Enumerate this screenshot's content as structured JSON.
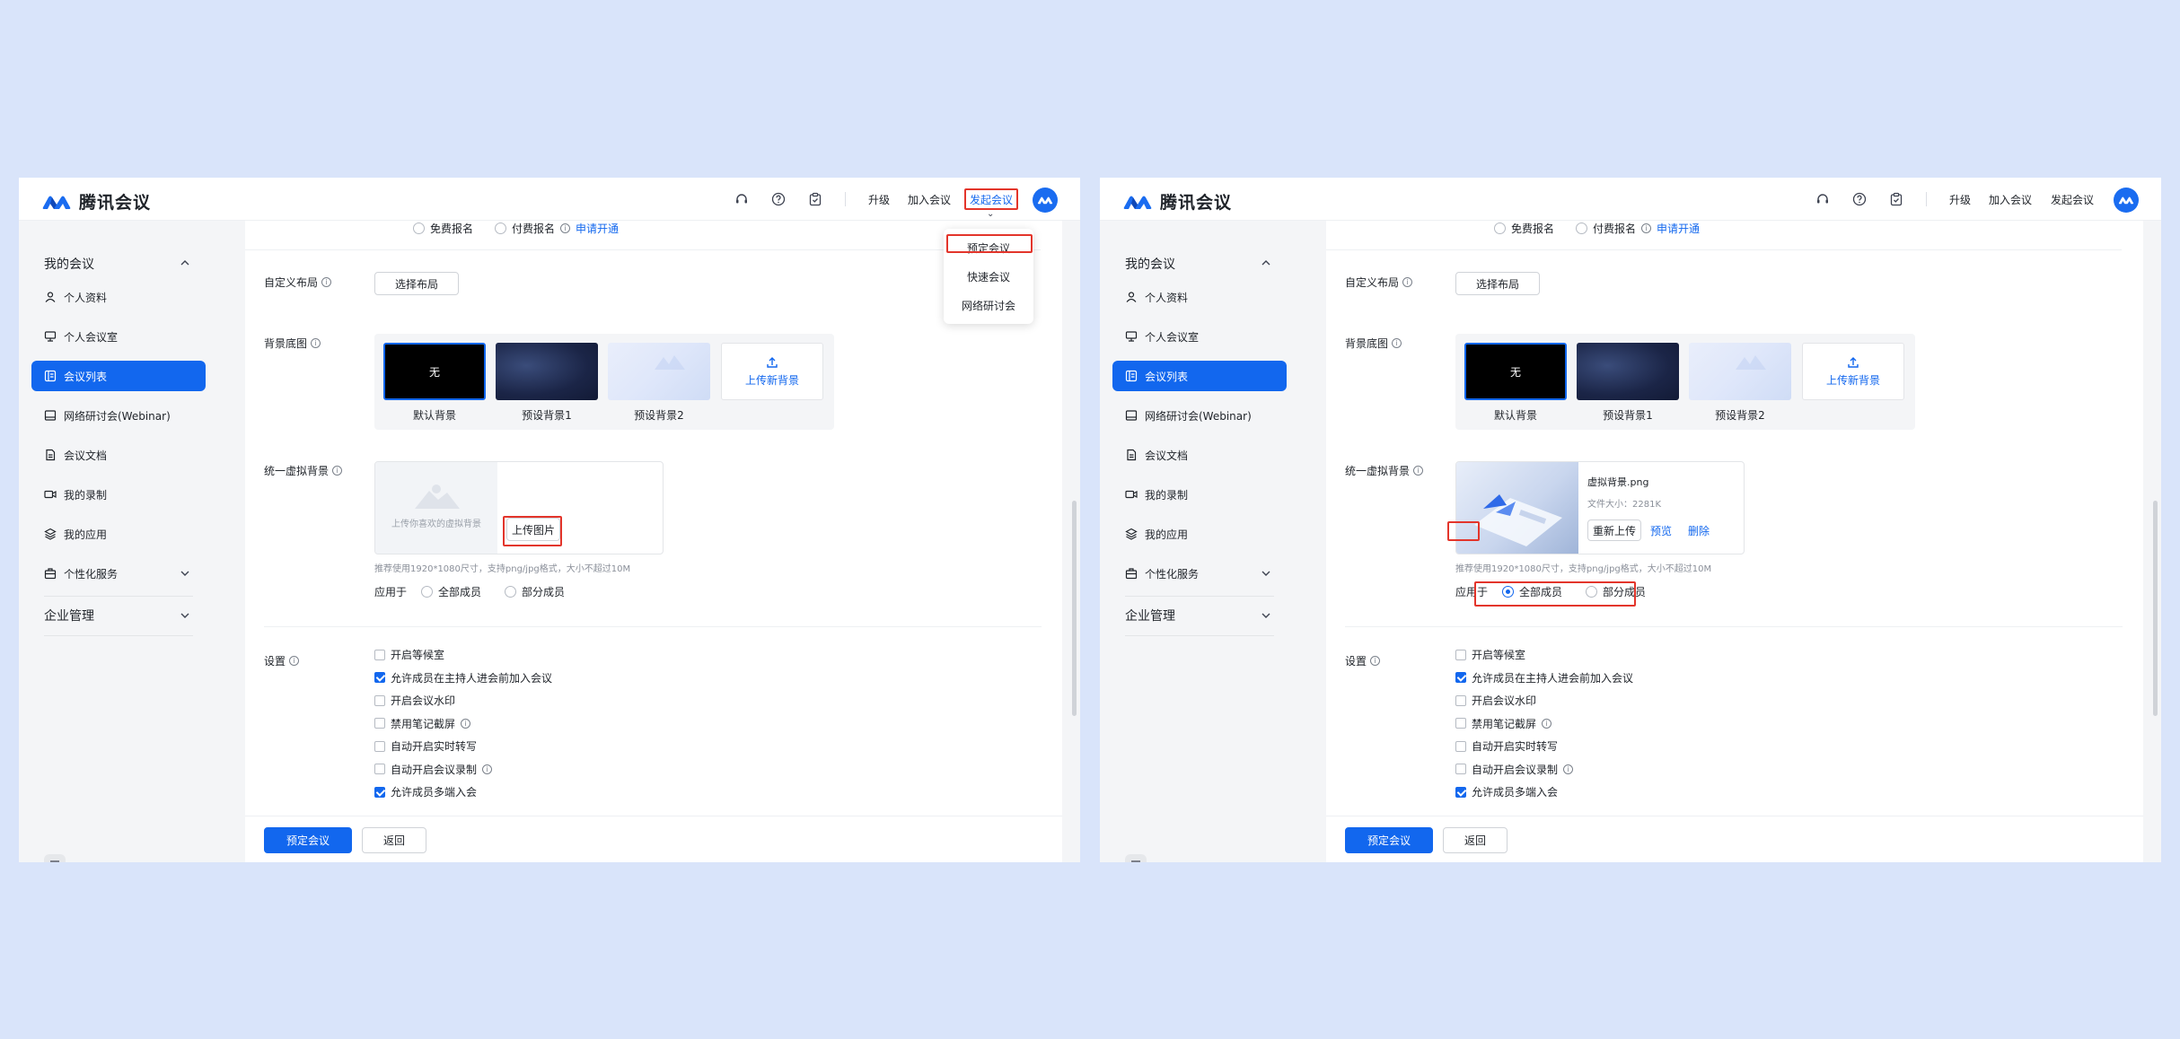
{
  "app": {
    "name": "腾讯会议"
  },
  "topbar": {
    "upgrade": "升级",
    "join": "加入会议",
    "start": "发起会议"
  },
  "dropdown": {
    "items": [
      "预定会议",
      "快速会议",
      "网络研讨会"
    ]
  },
  "sidebar": {
    "my_meetings": "我的会议",
    "items": [
      "个人资料",
      "个人会议室",
      "会议列表",
      "网络研讨会(Webinar)",
      "会议文档",
      "我的录制",
      "我的应用",
      "个性化服务"
    ],
    "enterprise": "企业管理"
  },
  "signup": {
    "free": "免费报名",
    "paid": "付费报名",
    "apply": "申请开通"
  },
  "layout": {
    "label": "自定义布局",
    "button": "选择布局"
  },
  "background": {
    "label": "背景底图",
    "tiles": [
      {
        "caption": "默认背景",
        "text": "无"
      },
      {
        "caption": "预设背景1"
      },
      {
        "caption": "预设背景2"
      }
    ],
    "upload": "上传新背景"
  },
  "virtual_bg": {
    "label": "统一虚拟背景",
    "placeholder": "上传你喜欢的虚拟背景",
    "upload_button": "上传图片",
    "hint": "推荐使用1920*1080尺寸，支持png/jpg格式，大小不超过10M",
    "file_name": "虚拟背景.png",
    "file_size": "文件大小：2281K",
    "reupload": "重新上传",
    "preview": "预览",
    "delete": "删除"
  },
  "apply_to": {
    "label": "应用于",
    "all": "全部成员",
    "some": "部分成员"
  },
  "settings": {
    "label": "设置",
    "options": [
      {
        "text": "开启等候室",
        "checked": false
      },
      {
        "text": "允许成员在主持人进会前加入会议",
        "checked": true
      },
      {
        "text": "开启会议水印",
        "checked": false
      },
      {
        "text": "禁用笔记截屏",
        "checked": false,
        "info": true
      },
      {
        "text": "自动开启实时转写",
        "checked": false
      },
      {
        "text": "自动开启会议录制",
        "checked": false,
        "info": true
      },
      {
        "text": "允许成员多端入会",
        "checked": true
      }
    ]
  },
  "footer": {
    "schedule": "预定会议",
    "back": "返回"
  },
  "colors": {
    "accent": "#1267ee",
    "highlight": "#e3352b",
    "background": "#d9e4fa"
  }
}
